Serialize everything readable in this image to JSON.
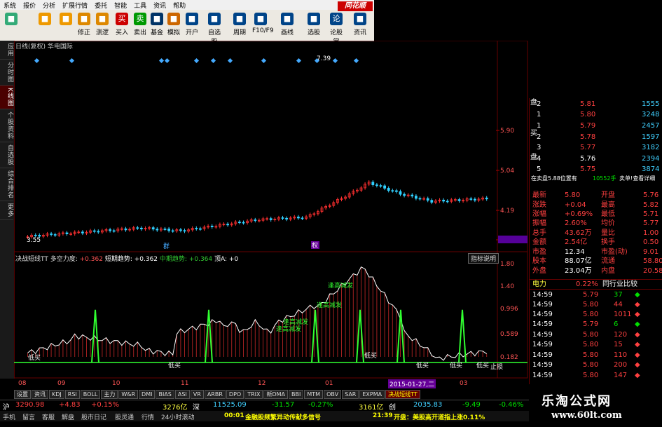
{
  "menu": [
    "系统",
    "报价",
    "分析",
    "扩展行情",
    "委托",
    "智能",
    "工具",
    "资讯",
    "帮助"
  ],
  "toolbar": {
    "buttons": [
      {
        "label": "",
        "name": "grid-icon",
        "color": "#3a7"
      },
      {
        "label": "",
        "name": "back-arrow-icon",
        "color": "#e90"
      },
      {
        "label": "",
        "name": "up-down-icon",
        "color": "#e90"
      },
      {
        "label": "修正",
        "name": "fix-icon",
        "color": "#d80"
      },
      {
        "label": "测逻",
        "name": "test-icon",
        "color": "#d80"
      },
      {
        "label": "买入",
        "name": "buy-icon",
        "color": "#c00",
        "glyph": "买"
      },
      {
        "label": "卖出",
        "name": "sell-icon",
        "color": "#090",
        "glyph": "卖"
      },
      {
        "label": "基金",
        "name": "fund-icon",
        "color": "#036"
      },
      {
        "label": "模拟",
        "name": "simulate-icon",
        "color": "#c60"
      },
      {
        "label": "开户",
        "name": "open-account-icon",
        "color": "#048"
      },
      {
        "label": "自选股",
        "name": "watchlist-icon",
        "color": "#048"
      },
      {
        "label": "周期",
        "name": "period-icon",
        "color": "#048"
      },
      {
        "label": "F10/F9",
        "name": "f10-icon",
        "color": "#048"
      },
      {
        "label": "画线",
        "name": "draw-line-icon",
        "color": "#048"
      },
      {
        "label": "选股",
        "name": "pick-stock-icon",
        "color": "#048"
      },
      {
        "label": "论股堂",
        "name": "forum-icon",
        "color": "#048",
        "glyph": "论"
      },
      {
        "label": "资讯",
        "name": "news-icon",
        "color": "#048"
      }
    ],
    "logo": "同花顺"
  },
  "left_tabs": [
    "应用",
    "分时图",
    "K线图",
    "个股资料",
    "自选股",
    "综合排名",
    "更多"
  ],
  "chart": {
    "title": "日线(复权)  华电国际",
    "price_labels": [
      "5.90",
      "5.04",
      "4.19",
      "3.55"
    ],
    "high_label": "7.39",
    "low_label": "3.55",
    "ind_labels": [
      "1.80",
      "1.40",
      "0.996",
      "0.589",
      "0.182"
    ],
    "markers": [
      "群",
      "权"
    ],
    "x_labels": [
      "08",
      "09",
      "10",
      "11",
      "12",
      "01",
      "02",
      "03"
    ],
    "date_highlight": "2015-01-27,二",
    "indicator": {
      "name": "决战短线TT",
      "f1": "多空力度: ",
      "v1": "+0.362",
      "f2": "短期趋势: ",
      "v2": "+0.362",
      "f3": "中期趋势: ",
      "v3": "+0.364",
      "f4": "顶A: ",
      "v4": "+0",
      "button": "指标说明"
    },
    "annotations": [
      "逢高减发",
      "逢高减发",
      "逢高减发",
      "逢高减发",
      "低买",
      "低买",
      "低买",
      "低买",
      "低买",
      "低买",
      "低买",
      "止损"
    ]
  },
  "bottom_tabs": [
    "设置",
    "资讯",
    "KDJ",
    "RSI",
    "BOLL",
    "主力",
    "W&R",
    "DMI",
    "BIAS",
    "ASI",
    "VR",
    "ARBR",
    "DPO",
    "TRIX",
    "新DMA",
    "BBI",
    "MTM",
    "OBV",
    "SAR",
    "EXPMA",
    "决战短线TT"
  ],
  "orderbook": {
    "sell_label": "盘",
    "buy_label_1": "买",
    "buy_label_2": "盘",
    "rows": [
      {
        "lvl": "2",
        "price": "5.81",
        "vol": "1555"
      },
      {
        "lvl": "1",
        "price": "5.80",
        "vol": "3248"
      },
      {
        "lvl": "1",
        "price": "5.79",
        "vol": "2457"
      },
      {
        "lvl": "2",
        "price": "5.78",
        "vol": "1597"
      },
      {
        "lvl": "3",
        "price": "5.77",
        "vol": "3182"
      },
      {
        "lvl": "4",
        "price": "5.76",
        "vol": "2394"
      },
      {
        "lvl": "5",
        "price": "5.75",
        "vol": "3874"
      }
    ],
    "summary": "在卖盘5.88位置有",
    "summary_vol": "10552手",
    "summary_link": "卖单!查看详细"
  },
  "quote": [
    {
      "k1": "最新",
      "v1": "5.80",
      "k2": "开盘",
      "v2": "5.76"
    },
    {
      "k1": "涨跌",
      "v1": "+0.04",
      "k2": "最高",
      "v2": "5.82"
    },
    {
      "k1": "涨幅",
      "v1": "+0.69%",
      "k2": "最低",
      "v2": "5.71"
    },
    {
      "k1": "振幅",
      "v1": "2.60%",
      "k2": "均价",
      "v2": "5.77"
    },
    {
      "k1": "总手",
      "v1": "43.62万",
      "k2": "量比",
      "v2": "1.00"
    },
    {
      "k1": "金额",
      "v1": "2.54亿",
      "k2": "换手",
      "v2": "0.50"
    },
    {
      "k1": "市盈",
      "v1": "12.34",
      "k2": "市盈(动)",
      "v2": "9.01"
    },
    {
      "k1": "股本",
      "v1": "88.07亿",
      "k2": "流通",
      "v2": "58.80亿"
    },
    {
      "k1": "外盘",
      "v1": "23.04万",
      "k2": "内盘",
      "v2": "20.58万"
    }
  ],
  "sector": {
    "name": "电力",
    "pct": "0.22%",
    "btn": "同行业比较"
  },
  "ticks": [
    {
      "t": "14:59",
      "p": "5.79",
      "v": "37",
      "d": "down"
    },
    {
      "t": "14:59",
      "p": "5.80",
      "v": "44",
      "d": "up"
    },
    {
      "t": "14:59",
      "p": "5.80",
      "v": "1011",
      "d": "up"
    },
    {
      "t": "14:59",
      "p": "5.79",
      "v": "6",
      "d": "down"
    },
    {
      "t": "14:59",
      "p": "5.80",
      "v": "120",
      "d": "up"
    },
    {
      "t": "14:59",
      "p": "5.80",
      "v": "15",
      "d": "up"
    },
    {
      "t": "14:59",
      "p": "5.80",
      "v": "110",
      "d": "up"
    },
    {
      "t": "14:59",
      "p": "5.80",
      "v": "200",
      "d": "up"
    },
    {
      "t": "14:59",
      "p": "5.80",
      "v": "147",
      "d": "up"
    }
  ],
  "status": {
    "idx1_name": "沪",
    "idx1_val": "3290.98",
    "idx1_chg": "+4.83",
    "idx1_pct": "+0.15%",
    "idx1_amt": "3276亿",
    "idx2_name": "深",
    "idx2_val": "11525.09",
    "idx2_chg": "-31.57",
    "idx2_pct": "-0.27%",
    "idx2_amt": "3161亿",
    "idx3_name": "创",
    "idx3_val": "2035.83",
    "idx3_chg": "-9.49",
    "idx3_pct": "-0.46%"
  },
  "status2": {
    "items": [
      "手机",
      "留言",
      "客服",
      "解盘",
      "股市日记",
      "股灵通",
      "行情",
      "24小时滚动"
    ],
    "news1_time": "00:01",
    "news1": "金融股频繁异动传献多信号",
    "news2_time": "21:39",
    "news2": "开盘：美股高开道指上涨0.11%"
  },
  "watermark": {
    "cn": "乐淘公式网",
    "url": "www.60lt.com"
  },
  "colors": {
    "up": "#ff4040",
    "down": "#40d0ff",
    "green": "#30ff30",
    "bg": "#000000",
    "axis": "#800000"
  }
}
